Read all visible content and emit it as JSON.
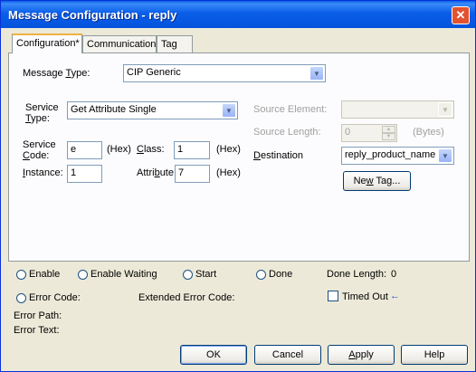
{
  "window": {
    "title": "Message Configuration - reply"
  },
  "tabs": [
    {
      "label": "Configuration*"
    },
    {
      "label": "Communication"
    },
    {
      "label": "Tag"
    }
  ],
  "config": {
    "message_type": {
      "label_pre": "Message ",
      "label_key": "T",
      "label_post": "ype:",
      "value": "CIP Generic"
    },
    "service_type": {
      "label_line1": "Service",
      "label_key": "T",
      "label_post": "ype:",
      "value": "Get Attribute Single"
    },
    "service_code": {
      "label_line1": "Service",
      "label_key": "C",
      "label_post": "ode:",
      "value": "e",
      "unit": "(Hex)"
    },
    "class": {
      "label_key": "C",
      "label_post": "lass:",
      "value": "1",
      "unit": "(Hex)"
    },
    "instance": {
      "label_key": "I",
      "label_post": "nstance:",
      "value": "1"
    },
    "attribute": {
      "label_pre": "Attri",
      "label_key": "b",
      "label_post": "ute:",
      "value": "7",
      "unit": "(Hex)"
    },
    "source_element": {
      "label": "Source Element:",
      "value": ""
    },
    "source_length": {
      "label": "Source Length:",
      "value": "0",
      "unit": "(Bytes)"
    },
    "destination": {
      "label_key": "D",
      "label_post": "estination",
      "value": "reply_product_name"
    },
    "new_tag_button": {
      "label_pre": "Ne",
      "label_key": "w",
      "label_post": " Tag..."
    }
  },
  "status": {
    "enable": "Enable",
    "enable_waiting": "Enable Waiting",
    "start": "Start",
    "done": "Done",
    "done_length_label": "Done Length:",
    "done_length_value": "0",
    "error_code": "Error Code:",
    "extended_error_code": "Extended Error Code:",
    "timed_out": "Timed Out",
    "timed_out_arrow": "←",
    "error_path": "Error Path:",
    "error_text": "Error Text:"
  },
  "buttons": {
    "ok": "OK",
    "cancel": "Cancel",
    "apply_key": "A",
    "apply_post": "pply",
    "help": "Help"
  }
}
